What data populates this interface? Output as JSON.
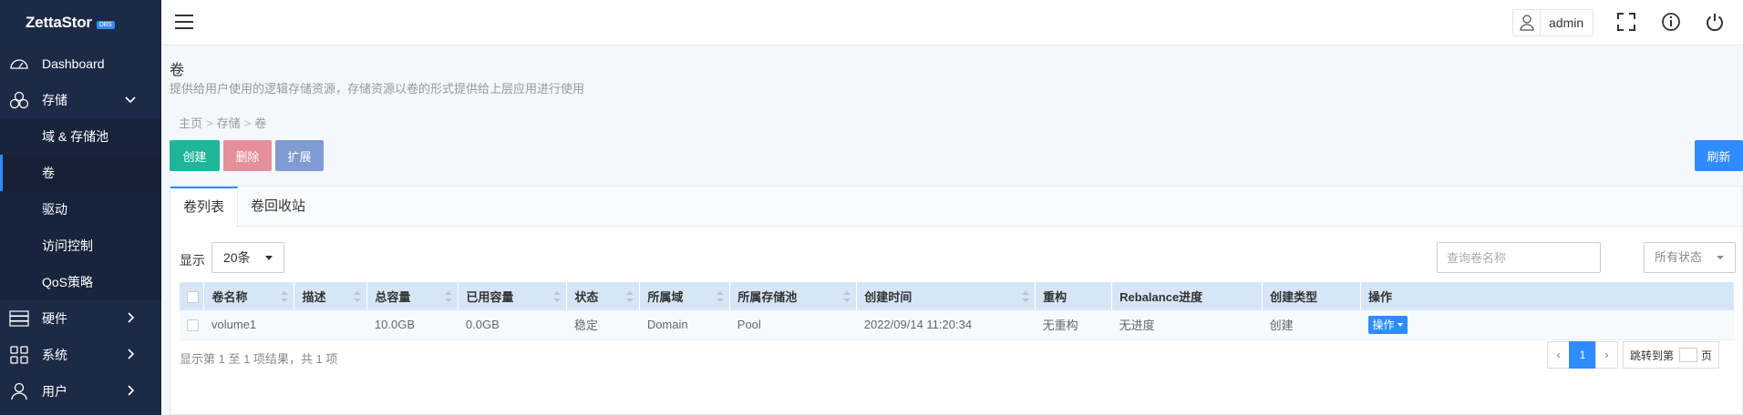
{
  "app": {
    "logo": "ZettaStor",
    "edition": "DBS"
  },
  "sidebar": {
    "items": [
      {
        "label": "Dashboard"
      },
      {
        "label": "存储"
      },
      {
        "label": "域 & 存储池"
      },
      {
        "label": "卷"
      },
      {
        "label": "驱动"
      },
      {
        "label": "访问控制"
      },
      {
        "label": "QoS策略"
      },
      {
        "label": "硬件"
      },
      {
        "label": "系统"
      },
      {
        "label": "用户"
      }
    ]
  },
  "header": {
    "username": "admin"
  },
  "page": {
    "title": "卷",
    "description": "提供给用户使用的逻辑存储资源，存储资源以卷的形式提供给上层应用进行使用",
    "breadcrumb": [
      "主页",
      "存储",
      "卷"
    ],
    "breadcrumb_sep": ">"
  },
  "toolbar": {
    "create": "创建",
    "delete": "删除",
    "extend": "扩展",
    "refresh": "刷新"
  },
  "tabs": [
    {
      "label": "卷列表"
    },
    {
      "label": "卷回收站"
    }
  ],
  "filters": {
    "show_label": "显示",
    "page_size": "20条",
    "search_placeholder": "查询卷名称",
    "status_filter": "所有状态"
  },
  "table": {
    "columns": [
      "卷名称",
      "描述",
      "总容量",
      "已用容量",
      "状态",
      "所属域",
      "所属存储池",
      "创建时间",
      "重构",
      "Rebalance进度",
      "创建类型",
      "操作"
    ],
    "rows": [
      {
        "name": "volume1",
        "description": "",
        "total": "10.0GB",
        "used": "0.0GB",
        "status": "稳定",
        "domain": "Domain",
        "pool": "Pool",
        "created": "2022/09/14 11:20:34",
        "rebuild": "无重构",
        "rebalance": "无进度",
        "create_type": "创建",
        "action": "操作"
      }
    ]
  },
  "pagination": {
    "summary": "显示第 1 至 1 项结果，共 1 项",
    "prev": "‹",
    "current": "1",
    "next": "›",
    "jump_label": "跳转到第",
    "jump_suffix": "页"
  },
  "colors": {
    "sidebar_bg": "#1c2a47",
    "accent": "#2f8cff",
    "create": "#1fb59a",
    "delete": "#e58f9b",
    "extend": "#7f9bd2",
    "stable": "#27a84a"
  }
}
